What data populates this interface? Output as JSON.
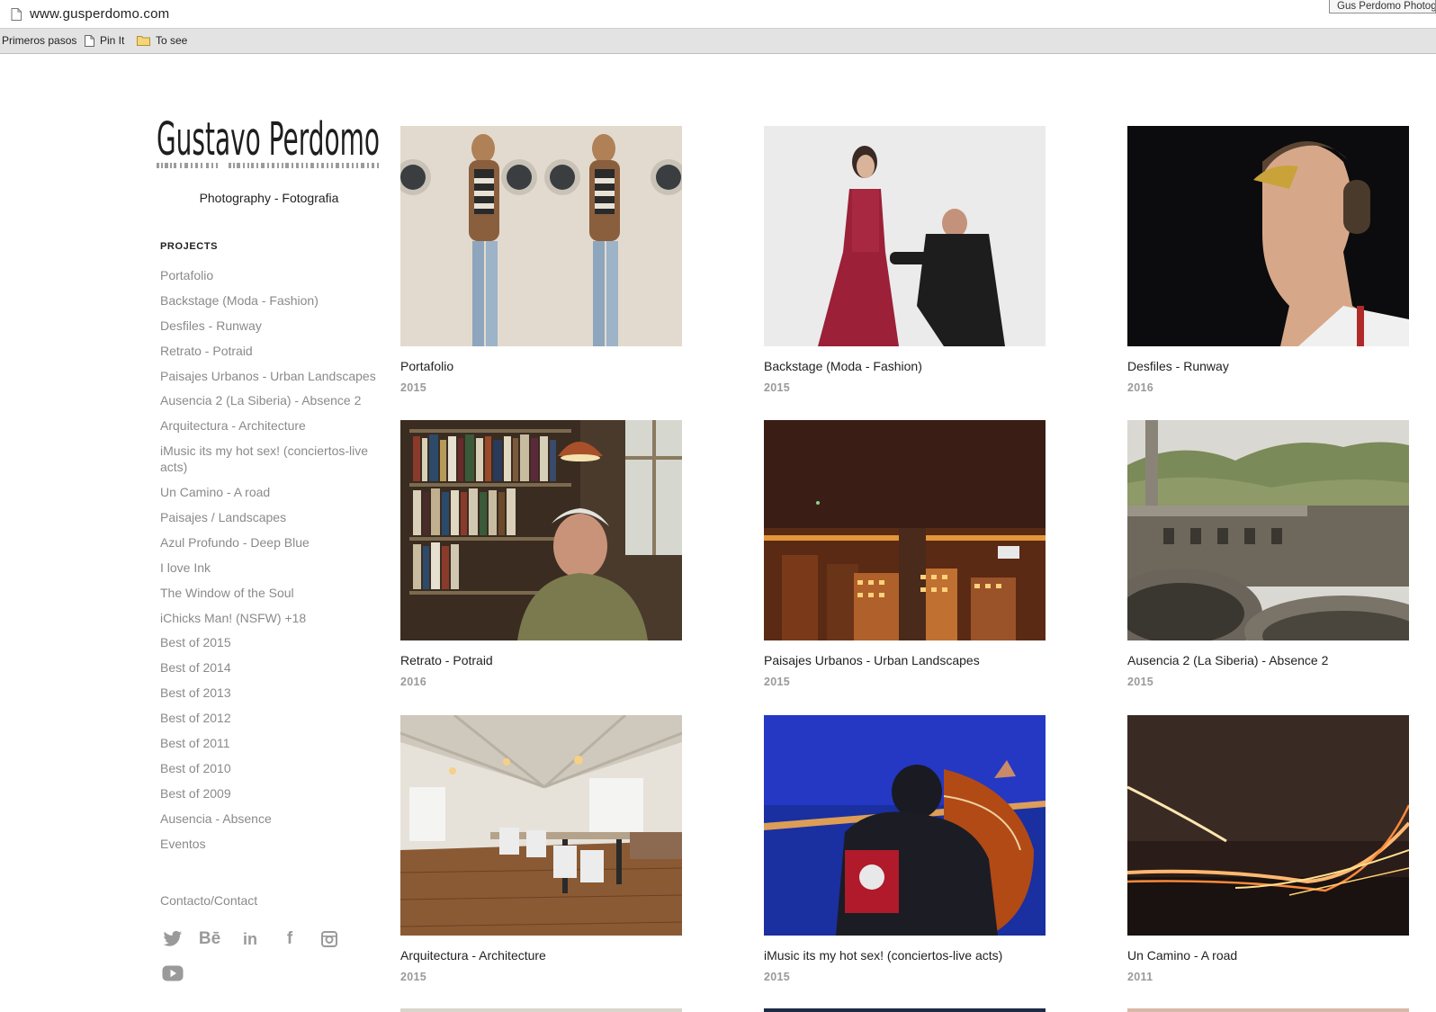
{
  "browser": {
    "url": "www.gusperdomo.com",
    "tooltip": "Gus Perdomo Photography",
    "bookmarks": [
      {
        "label": "Primeros pasos",
        "icon": "none"
      },
      {
        "label": "Pin It",
        "icon": "page-icon"
      },
      {
        "label": "To see",
        "icon": "folder-icon"
      }
    ]
  },
  "site": {
    "logo_text": "Gustavo Perdomo",
    "subtitle": "Photography - Fotografia",
    "projects_heading": "PROJECTS",
    "nav": [
      "Portafolio",
      "Backstage (Moda - Fashion)",
      "Desfiles - Runway",
      "Retrato - Potraid",
      "Paisajes Urbanos - Urban Landscapes",
      "Ausencia 2 (La Siberia) - Absence 2",
      "Arquitectura - Architecture",
      "iMusic its my hot sex! (conciertos-live acts)",
      "Un Camino - A road",
      "Paisajes / Landscapes",
      "Azul Profundo - Deep Blue",
      "I love Ink",
      "The Window of the Soul",
      "iChicks Man! (NSFW) +18",
      "Best of 2015",
      "Best of 2014",
      "Best of 2013",
      "Best of 2012",
      "Best of 2011",
      "Best of 2010",
      "Best of 2009",
      "Ausencia - Absence",
      "Eventos"
    ],
    "contact": "Contacto/Contact",
    "social": [
      "twitter-icon",
      "behance-icon",
      "linkedin-icon",
      "facebook-icon",
      "instagram-icon",
      "youtube-icon"
    ]
  },
  "projects": [
    {
      "title": "Portafolio",
      "year": "2015"
    },
    {
      "title": "Backstage (Moda - Fashion)",
      "year": "2015"
    },
    {
      "title": "Desfiles - Runway",
      "year": "2016"
    },
    {
      "title": "Retrato - Potraid",
      "year": "2016"
    },
    {
      "title": "Paisajes Urbanos - Urban Landscapes",
      "year": "2015"
    },
    {
      "title": "Ausencia 2 (La Siberia) - Absence 2",
      "year": "2015"
    },
    {
      "title": "Arquitectura - Architecture",
      "year": "2015"
    },
    {
      "title": "iMusic its my hot sex! (conciertos-live acts)",
      "year": "2015"
    },
    {
      "title": "Un Camino - A road",
      "year": "2011"
    }
  ]
}
